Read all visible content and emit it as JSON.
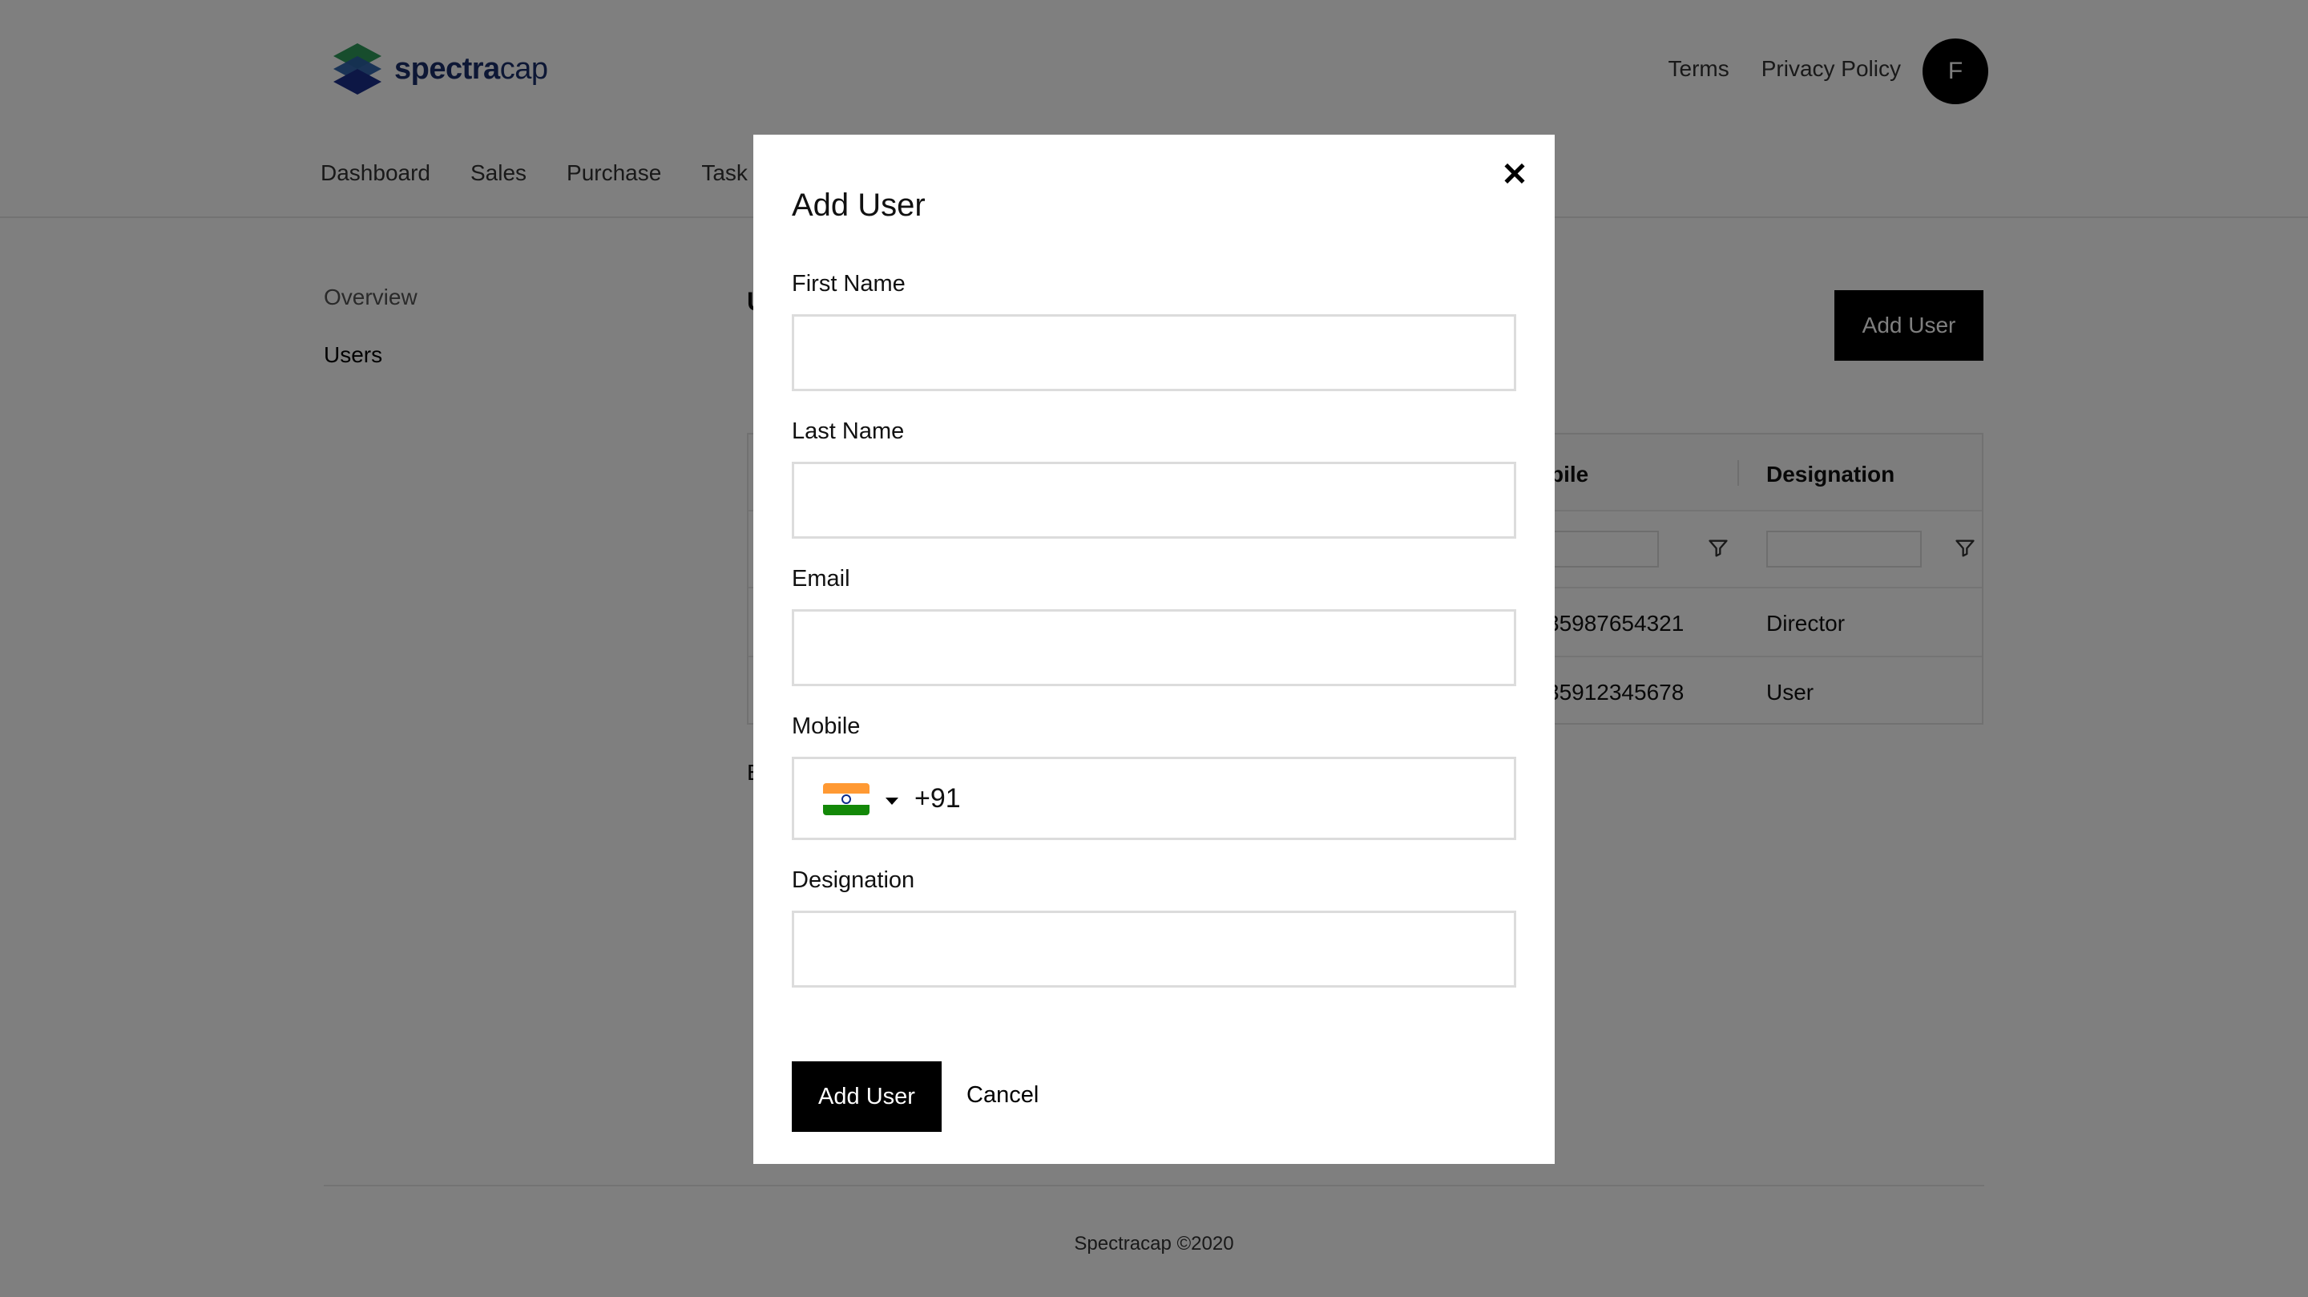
{
  "brand": {
    "name_bold": "spectra",
    "name_light": "cap",
    "colors": [
      "#2e9a5a",
      "#2a5fa8",
      "#1a2e8a"
    ]
  },
  "header": {
    "links": [
      "Terms",
      "Privacy Policy"
    ],
    "avatar_initial": "F"
  },
  "main_nav": [
    "Dashboard",
    "Sales",
    "Purchase",
    "Task"
  ],
  "side_nav": {
    "overview": "Overview",
    "users": "Users"
  },
  "content": {
    "title": "U",
    "add_user_label": "Add User",
    "pager_text": "E"
  },
  "table": {
    "columns": {
      "mobile": "bile",
      "designation": "Designation"
    },
    "rows": [
      {
        "mobile": "35987654321",
        "designation": "Director"
      },
      {
        "mobile": "35912345678",
        "designation": "User"
      }
    ],
    "filter_icon": "filter-icon"
  },
  "footer": {
    "text": "Spectracap ©2020"
  },
  "modal": {
    "title": "Add User",
    "close_icon": "close-icon",
    "fields": {
      "first_name": {
        "label": "First Name",
        "value": ""
      },
      "last_name": {
        "label": "Last Name",
        "value": ""
      },
      "email": {
        "label": "Email",
        "value": ""
      },
      "mobile": {
        "label": "Mobile",
        "country": "India flag",
        "dial_code": "+91"
      },
      "designation": {
        "label": "Designation",
        "value": ""
      }
    },
    "submit_label": "Add User",
    "cancel_label": "Cancel"
  }
}
